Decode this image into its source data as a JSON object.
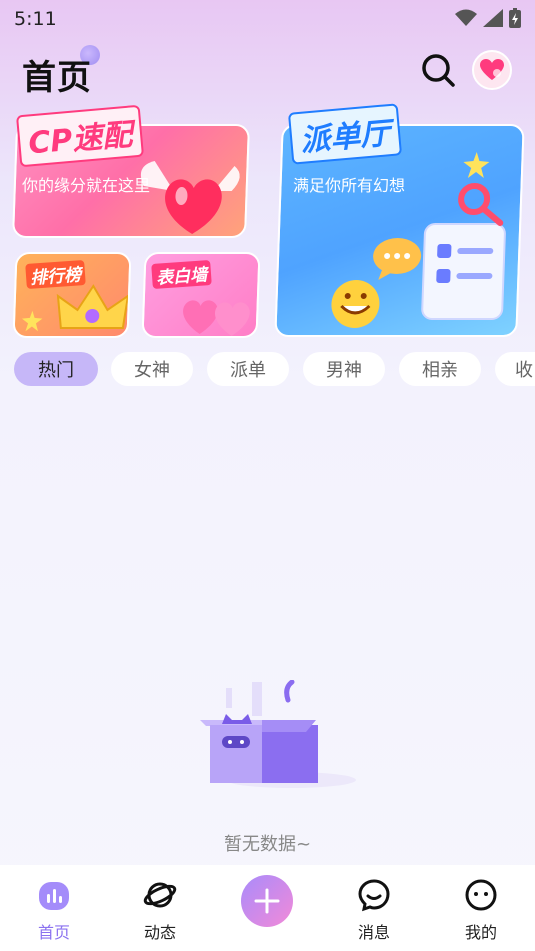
{
  "status_bar": {
    "time": "5:11"
  },
  "header": {
    "title": "首页"
  },
  "cards": {
    "cp": {
      "badge": "CP速配",
      "subtitle": "你的缘分就在这里"
    },
    "paidan": {
      "badge": "派单厅",
      "subtitle": "满足你所有幻想"
    },
    "rank": {
      "badge": "排行榜"
    },
    "wall": {
      "badge": "表白墙"
    }
  },
  "tabs": [
    {
      "label": "热门",
      "active": true
    },
    {
      "label": "女神",
      "active": false
    },
    {
      "label": "派单",
      "active": false
    },
    {
      "label": "男神",
      "active": false
    },
    {
      "label": "相亲",
      "active": false
    },
    {
      "label": "收",
      "active": false
    }
  ],
  "empty_state": {
    "text": "暂无数据~"
  },
  "bottom_nav": [
    {
      "label": "首页",
      "icon": "home-icon",
      "active": true
    },
    {
      "label": "动态",
      "icon": "planet-icon",
      "active": false
    },
    {
      "label": "消息",
      "icon": "message-icon",
      "active": false
    },
    {
      "label": "我的",
      "icon": "profile-icon",
      "active": false
    }
  ],
  "colors": {
    "accent": "#8b72f0",
    "tab_active_bg": "#c6b7f8",
    "cp_pink": "#ff3b7e",
    "paidan_blue": "#1f7dff"
  }
}
